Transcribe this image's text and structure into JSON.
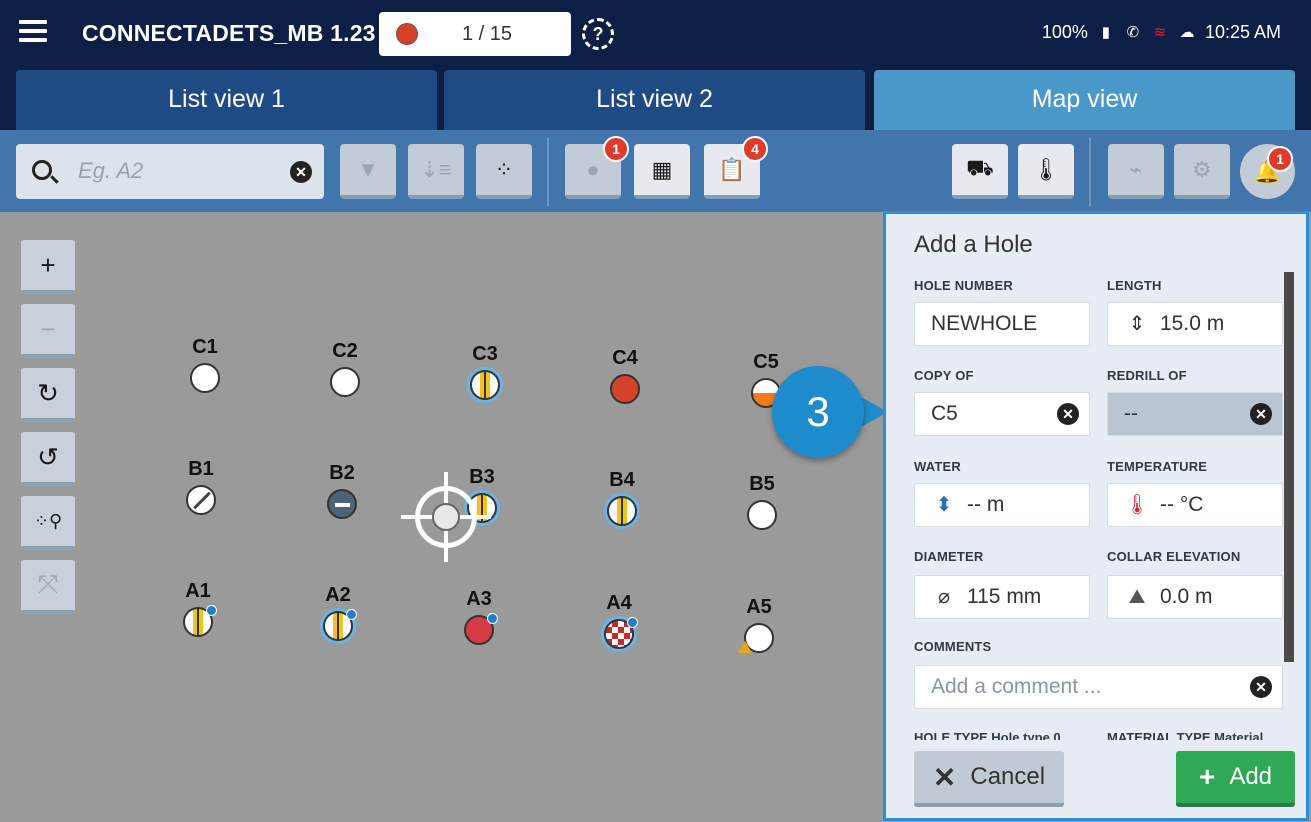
{
  "app": {
    "title": "CONNECTADETS_MB 1.23",
    "counter": "1 / 15"
  },
  "status": {
    "battery": "100%",
    "time": "10:25 AM"
  },
  "tabs": [
    {
      "label": "List view 1"
    },
    {
      "label": "List view 2"
    },
    {
      "label": "Map view"
    }
  ],
  "search": {
    "placeholder": "Eg. A2",
    "value": ""
  },
  "badges": {
    "points": "1",
    "clipboard": "4",
    "bell": "1"
  },
  "holes": [
    {
      "label": "C1",
      "style": "plain"
    },
    {
      "label": "C2",
      "style": "plain"
    },
    {
      "label": "C3",
      "style": "charged-ring"
    },
    {
      "label": "C4",
      "style": "red"
    },
    {
      "label": "C5",
      "style": "half-orange"
    },
    {
      "label": "B1",
      "style": "slash"
    },
    {
      "label": "B2",
      "style": "blocked"
    },
    {
      "label": "B3",
      "style": "charged-ring"
    },
    {
      "label": "B4",
      "style": "charged-ring"
    },
    {
      "label": "B5",
      "style": "plain"
    },
    {
      "label": "A1",
      "style": "charged-dot"
    },
    {
      "label": "A2",
      "style": "charged-ring-dot"
    },
    {
      "label": "A3",
      "style": "drilled-dot"
    },
    {
      "label": "A4",
      "style": "checker-dot"
    },
    {
      "label": "A5",
      "style": "plain-triangle"
    }
  ],
  "callout": {
    "number": "3"
  },
  "panel": {
    "title": "Add a Hole",
    "hole_number": {
      "label": "HOLE NUMBER",
      "value": "NEWHOLE"
    },
    "length": {
      "label": "LENGTH",
      "value": "15.0  m"
    },
    "copy_of": {
      "label": "COPY OF",
      "value": "C5"
    },
    "redrill_of": {
      "label": "REDRILL OF",
      "value": "--"
    },
    "water": {
      "label": "WATER",
      "value": "-- m"
    },
    "temperature": {
      "label": "TEMPERATURE",
      "value": "-- °C"
    },
    "diameter": {
      "label": "DIAMETER",
      "value": "115 mm"
    },
    "collar_elevation": {
      "label": "COLLAR ELEVATION",
      "value": "0.0 m"
    },
    "comments": {
      "label": "COMMENTS",
      "placeholder": "Add a comment ...",
      "value": ""
    },
    "cut_labels": {
      "hole_type": "HOLE TYPE Hole type 0",
      "material_type": "MATERIAL TYPE Material"
    },
    "cancel_label": "Cancel",
    "add_label": "Add"
  },
  "colors": {
    "topbar": "#0d1f45",
    "toolbar": "#4175ac",
    "tab_active": "#4a98c8",
    "panel_border": "#2a8ee0",
    "add_button": "#2ea855",
    "callout": "#1e8ccc"
  }
}
